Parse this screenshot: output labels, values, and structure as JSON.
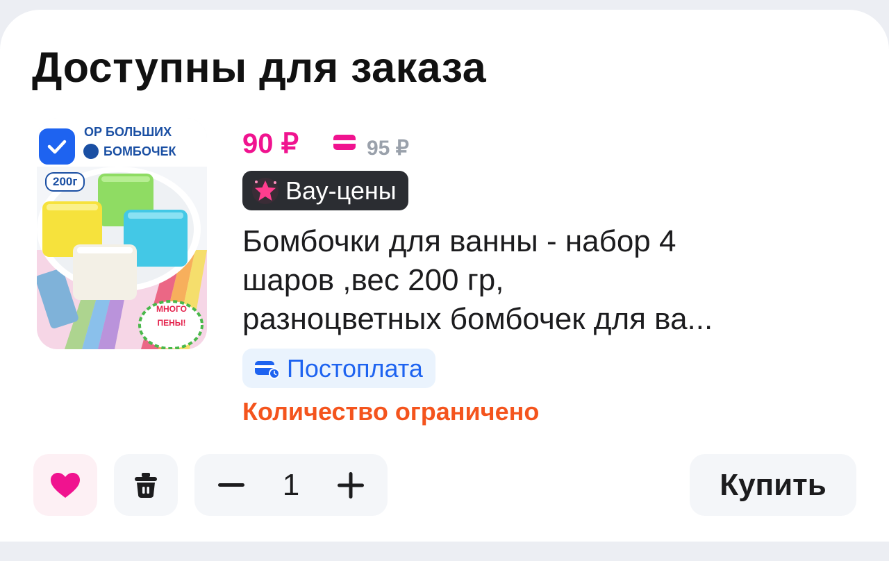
{
  "section": {
    "title": "Доступны для заказа"
  },
  "product": {
    "thumbnail_texts": {
      "line1": "ОР БОЛЬШИХ",
      "line2": "БОМБОЧЕК",
      "weight": "200г",
      "foam_line1": "МНОГО",
      "foam_line2": "ПЕНЫ!"
    },
    "checkbox_checked": true,
    "price": "90 ₽",
    "old_price": "95 ₽",
    "promo_badge": "Вау-цены",
    "name_lines": [
      "Бомбочки для ванны - набор 4",
      "шаров ,вес 200 гр,",
      "разноцветных бомбочек для ва..."
    ],
    "payment_badge": "Постоплата",
    "stock_note": "Количество ограничено",
    "quantity": "1"
  },
  "actions": {
    "buy_label": "Купить"
  },
  "icons": {
    "checkbox": "check-icon",
    "payment_card": "card-icon",
    "promo": "star-icon",
    "postpay": "card-clock-icon",
    "favorite": "heart-icon",
    "delete": "trash-icon",
    "decrease": "minus-icon",
    "increase": "plus-icon"
  },
  "colors": {
    "price": "#f0138f",
    "old_price": "#9aa1ab",
    "checkbox": "#1e63f0",
    "promo_bg": "#2b2d32",
    "postpay_text": "#1e63f0",
    "postpay_bg": "#eaf3fd",
    "stock_note": "#f4541d",
    "heart": "#f0138f"
  }
}
